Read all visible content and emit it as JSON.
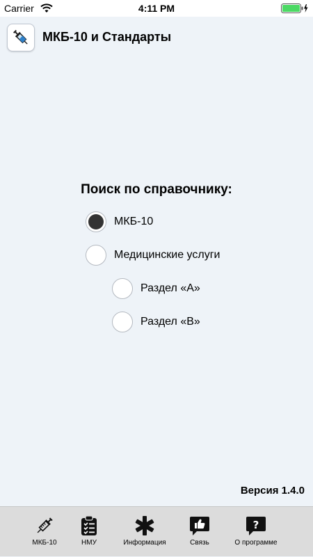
{
  "status_bar": {
    "carrier": "Carrier",
    "time": "4:11 PM",
    "wifi_icon": "wifi-icon",
    "battery_icon": "battery-charging-icon"
  },
  "header": {
    "app_icon": "syringe-icon",
    "title": "МКБ-10 и Стандарты"
  },
  "search": {
    "heading": "Поиск по справочнику:",
    "options": [
      {
        "label": "МКБ-10",
        "selected": true
      },
      {
        "label": "Медицинские услуги",
        "selected": false
      },
      {
        "label": "Раздел «А»",
        "selected": false
      },
      {
        "label": "Раздел «В»",
        "selected": false
      }
    ]
  },
  "version": "Версия 1.4.0",
  "tabs": [
    {
      "label": "МКБ-10",
      "icon": "syringe-icon"
    },
    {
      "label": "НМУ",
      "icon": "clipboard-checklist-icon"
    },
    {
      "label": "Информация",
      "icon": "asterisk-icon"
    },
    {
      "label": "Связь",
      "icon": "thumbs-up-chat-icon"
    },
    {
      "label": "О программе",
      "icon": "question-chat-icon"
    }
  ]
}
